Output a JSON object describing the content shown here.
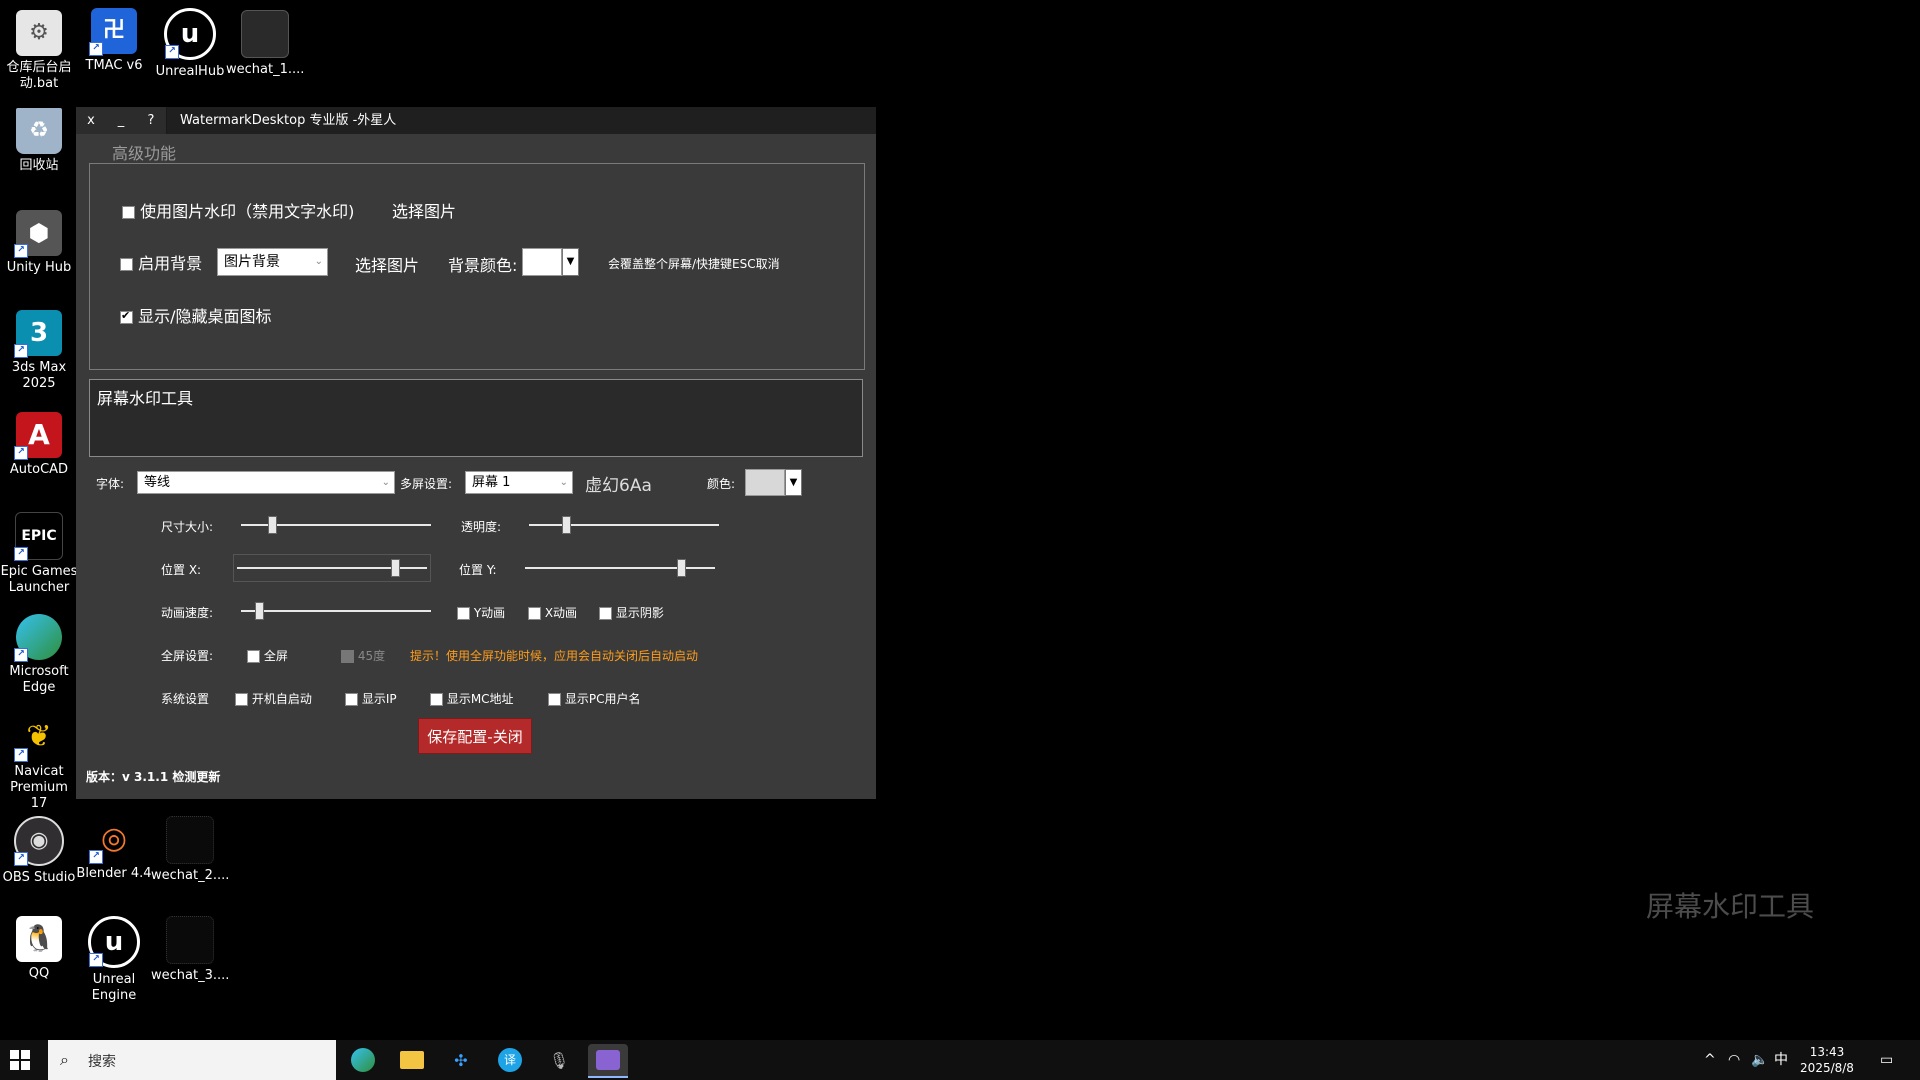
{
  "desktop": {
    "icons": [
      {
        "label": "仓库后台启动.bat"
      },
      {
        "label": "TMAC v6"
      },
      {
        "label": "UnrealHub"
      },
      {
        "label": "wechat_1...."
      },
      {
        "label": "回收站"
      },
      {
        "label": "Unity Hub"
      },
      {
        "label": "3ds Max 2025"
      },
      {
        "label": "AutoCAD"
      },
      {
        "label": "Epic Games Launcher"
      },
      {
        "label": "Microsoft Edge"
      },
      {
        "label": "Navicat Premium 17"
      },
      {
        "label": "OBS Studio"
      },
      {
        "label": "Blender 4.4"
      },
      {
        "label": "wechat_2...."
      },
      {
        "label": "QQ"
      },
      {
        "label": "Unreal Engine"
      },
      {
        "label": "wechat_3...."
      }
    ],
    "watermark_text": "屏幕水印工具"
  },
  "window": {
    "title": "WatermarkDesktop 专业版 -外星人",
    "close_label": "x",
    "minimize_label": "_",
    "help_label": "?",
    "advanced_section_label": "高级功能",
    "advanced": {
      "use_image_watermark": {
        "label": "使用图片水印（禁用文字水印)",
        "checked": false
      },
      "choose_image_1": "选择图片",
      "enable_background": {
        "label": "启用背景",
        "checked": false
      },
      "background_type_select": "图片背景",
      "choose_image_2": "选择图片",
      "background_color_label": "背景颜色:",
      "background_color": "#ffffff",
      "background_note": "会覆盖整个屏幕/快捷键ESC取消",
      "toggle_desktop_icons": {
        "label": "显示/隐藏桌面图标",
        "checked": true
      }
    },
    "watermark_text_value": "屏幕水印工具",
    "font_label": "字体:",
    "font_value": "等线",
    "multiscreen_label": "多屏设置:",
    "screen_value": "屏幕 1",
    "font_preview": "虚幻6Aa",
    "color_label": "颜色:",
    "text_color": "#d8d8d8",
    "size_label": "尺寸大小:",
    "size_value": 0.15,
    "opacity_label": "透明度:",
    "opacity_value": 0.18,
    "pos_x_label": "位置    X:",
    "pos_x_value": 0.85,
    "pos_y_label": "位置 Y:",
    "pos_y_value": 0.84,
    "anim_speed_label": "动画速度:",
    "anim_speed_value": 0.08,
    "y_anim": {
      "label": "Y动画",
      "checked": false
    },
    "x_anim": {
      "label": "X动画",
      "checked": false
    },
    "show_shadow": {
      "label": "显示阴影",
      "checked": false
    },
    "fullscreen_settings_label": "全屏设置:",
    "fullscreen": {
      "label": "全屏",
      "checked": false
    },
    "deg45": {
      "label": "45度",
      "checked": false
    },
    "fullscreen_tip": "提示！使用全屏功能时候，应用会自动关闭后自动启动",
    "system_settings_label": "系统设置",
    "autostart": {
      "label": "开机自启动",
      "checked": false
    },
    "show_ip": {
      "label": "显示IP",
      "checked": false
    },
    "show_mac": {
      "label": "显示MC地址",
      "checked": false
    },
    "show_pc_user": {
      "label": "显示PC用户名",
      "checked": false
    },
    "save_close_button": "保存配置-关闭",
    "version_text": "版本：v 3.1.1 检测更新"
  },
  "taskbar": {
    "search_placeholder": "搜索",
    "ime_indicator": "中",
    "time": "13:43",
    "date": "2025/8/8"
  }
}
